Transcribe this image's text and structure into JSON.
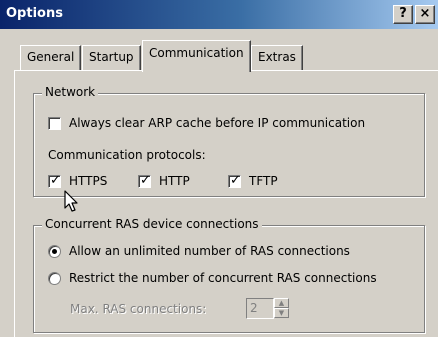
{
  "window": {
    "title": "Options",
    "help_label": "?",
    "close_label": "×"
  },
  "tabs": [
    {
      "label": "General",
      "active": false
    },
    {
      "label": "Startup",
      "active": false
    },
    {
      "label": "Communication",
      "active": true
    },
    {
      "label": "Extras",
      "active": false
    }
  ],
  "network": {
    "legend": "Network",
    "arp_label": "Always clear ARP cache before IP communication",
    "arp_checked": false,
    "protocols_label": "Communication protocols:",
    "protocols": [
      {
        "label": "HTTPS",
        "checked": true
      },
      {
        "label": "HTTP",
        "checked": true
      },
      {
        "label": "TFTP",
        "checked": true
      }
    ]
  },
  "ras": {
    "legend": "Concurrent RAS device connections",
    "option_unlimited": "Allow an unlimited number of RAS connections",
    "option_restrict": "Restrict the number of concurrent RAS connections",
    "selected": "unlimited",
    "max_label": "Max. RAS connections:",
    "max_value": "2"
  },
  "colors": {
    "titlebar_start": "#0a246a",
    "titlebar_end": "#a6caf0",
    "face": "#d4d0c8"
  }
}
